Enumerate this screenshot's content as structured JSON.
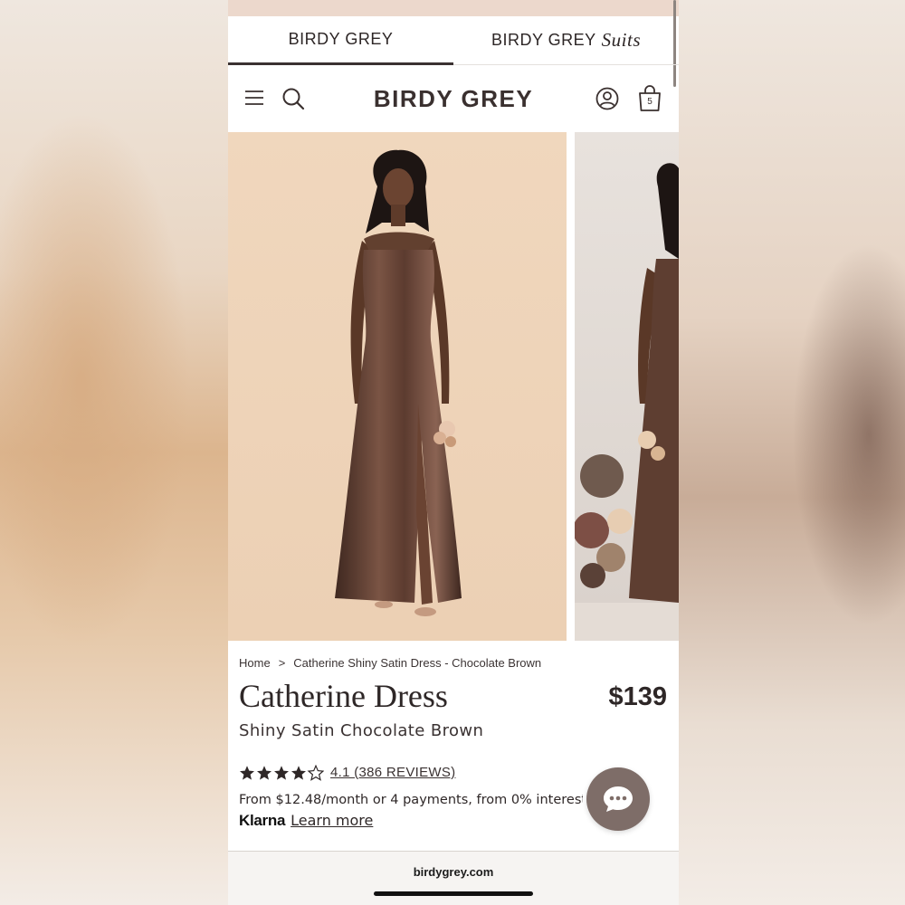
{
  "brand_tabs": [
    {
      "label": "BIRDY GREY",
      "suffix": "",
      "active": true
    },
    {
      "label": "BIRDY GREY",
      "suffix": "Suits",
      "active": false
    }
  ],
  "header": {
    "logo": "BIRDY GREY",
    "cart_count": "5",
    "icons": [
      "menu-icon",
      "search-icon",
      "account-icon",
      "cart-icon"
    ]
  },
  "breadcrumb": {
    "home": "Home",
    "separator": ">",
    "current": "Catherine Shiny Satin Dress - Chocolate Brown"
  },
  "product": {
    "title": "Catherine Dress",
    "subtitle": "Shiny Satin Chocolate Brown",
    "price": "$139",
    "rating": 4.1,
    "stars_max": 5,
    "reviews_text": "4.1 (386 REVIEWS)",
    "financing_text": "From $12.48/month or 4 payments, from 0% interest",
    "klarna_logo": "Klarna",
    "learn_more": "Learn more"
  },
  "gallery": {
    "images": [
      "dress-front-photo",
      "dress-side-photo"
    ]
  },
  "footer": {
    "url": "birdygrey.com"
  },
  "colors": {
    "accent_dark": "#3b3131",
    "dress_brown": "#5a3a30",
    "chat_button": "#7e6d68",
    "photo_backdrop": "#efd3b8"
  }
}
